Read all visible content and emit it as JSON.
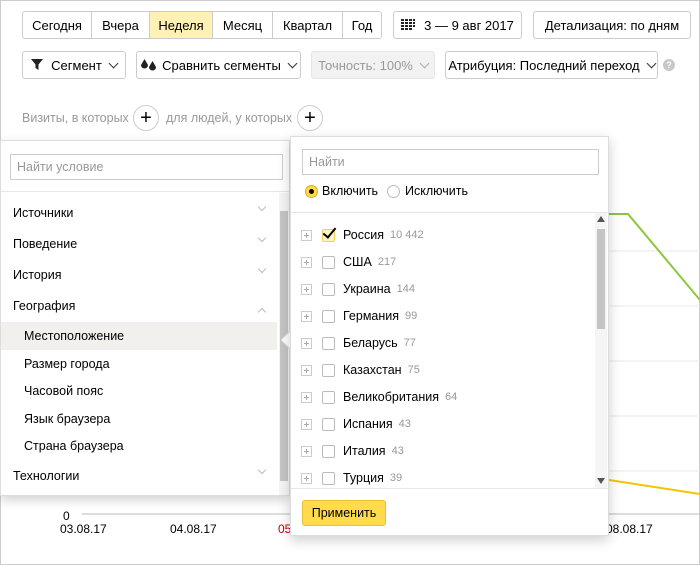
{
  "toolbar": {
    "periods": [
      "Сегодня",
      "Вчера",
      "Неделя",
      "Месяц",
      "Квартал",
      "Год"
    ],
    "active_period": "Неделя",
    "date_range": "3 — 9 авг 2017",
    "detail": "Детализация: по дням"
  },
  "filters": {
    "segment": "Сегмент",
    "compare": "Сравнить сегменты",
    "accuracy": "Точность: 100%",
    "attribution": "Атрибуция: Последний переход",
    "help": "?"
  },
  "segment_row": {
    "visits_text": "Визиты, в которых",
    "people_text": "для людей, у которых"
  },
  "chart": {
    "zero_label": "0",
    "x_labels": [
      "03.08.17",
      "04.08.17",
      "05",
      "08.08.17"
    ],
    "x_label_highlight_color": "#cc0000",
    "series_colors": [
      "#8cc63f",
      "#f5c400"
    ]
  },
  "left_panel": {
    "search_placeholder": "Найти условие",
    "categories": [
      {
        "label": "Источники",
        "expanded": false
      },
      {
        "label": "Поведение",
        "expanded": false
      },
      {
        "label": "История",
        "expanded": false
      },
      {
        "label": "География",
        "expanded": true
      },
      {
        "label": "Технологии",
        "expanded": false
      }
    ],
    "geo_items": [
      "Местоположение",
      "Размер города",
      "Часовой пояс",
      "Язык браузера",
      "Страна браузера"
    ],
    "selected_item": "Местоположение"
  },
  "right_panel": {
    "search_placeholder": "Найти",
    "include_label": "Включить",
    "exclude_label": "Исключить",
    "mode": "include",
    "countries": [
      {
        "name": "Россия",
        "count": "10 442",
        "checked": true
      },
      {
        "name": "США",
        "count": "217",
        "checked": false
      },
      {
        "name": "Украина",
        "count": "144",
        "checked": false
      },
      {
        "name": "Германия",
        "count": "99",
        "checked": false
      },
      {
        "name": "Беларусь",
        "count": "77",
        "checked": false
      },
      {
        "name": "Казахстан",
        "count": "75",
        "checked": false
      },
      {
        "name": "Великобритания",
        "count": "64",
        "checked": false
      },
      {
        "name": "Испания",
        "count": "43",
        "checked": false
      },
      {
        "name": "Италия",
        "count": "43",
        "checked": false
      },
      {
        "name": "Турция",
        "count": "39",
        "checked": false
      }
    ],
    "apply_label": "Применить"
  }
}
